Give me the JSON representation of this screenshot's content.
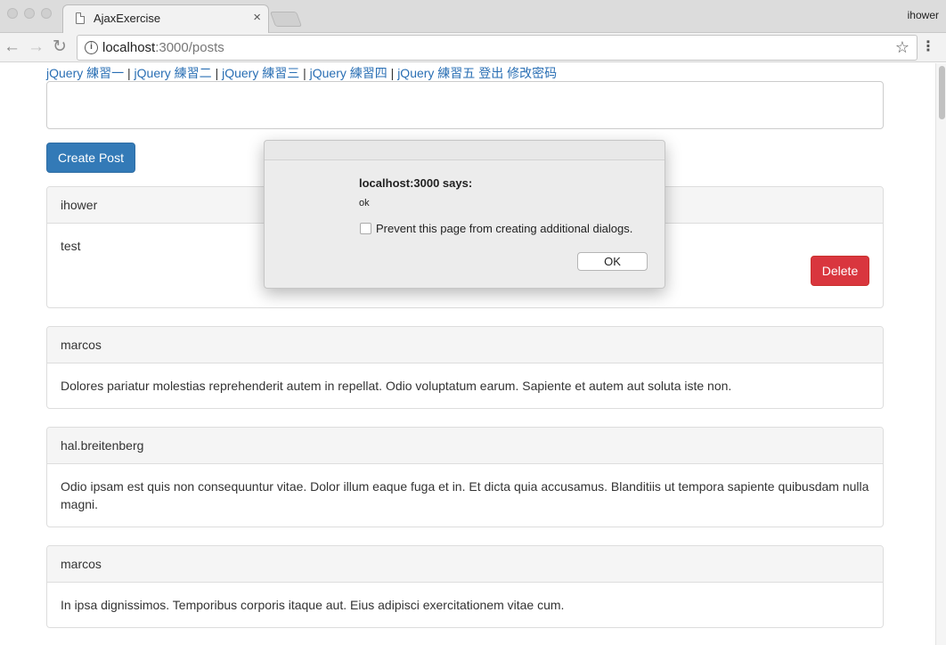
{
  "browser": {
    "tab_title": "AjaxExercise",
    "tab_close": "×",
    "profile_name": "ihower",
    "url_host": "localhost",
    "url_path": ":3000/posts",
    "back_glyph": "←",
    "forward_glyph": "→",
    "reload_glyph": "↻",
    "info_glyph": "i",
    "star_glyph": "☆",
    "menu_glyph": "⋮"
  },
  "nav": {
    "links": [
      "jQuery 練習一",
      "jQuery 練習二",
      "jQuery 練習三",
      "jQuery 練習四",
      "jQuery 練習五"
    ],
    "separator": "|",
    "logout": "登出",
    "change_password": "修改密码"
  },
  "form": {
    "textarea_value": "",
    "create_button": "Create Post"
  },
  "posts": [
    {
      "author": "ihower",
      "body": "test",
      "delete_label": "Delete"
    },
    {
      "author": "marcos",
      "body": "Dolores pariatur molestias reprehenderit autem in repellat. Odio voluptatum earum. Sapiente et autem aut soluta iste non."
    },
    {
      "author": "hal.breitenberg",
      "body": "Odio ipsam est quis non consequuntur vitae. Dolor illum eaque fuga et in. Et dicta quia accusamus. Blanditiis ut tempora sapiente quibusdam nulla magni."
    },
    {
      "author": "marcos",
      "body": "In ipsa dignissimos. Temporibus corporis itaque aut. Eius adipisci exercitationem vitae cum."
    }
  ],
  "dialog": {
    "title": "localhost:3000 says:",
    "message": "ok",
    "checkbox_label": "Prevent this page from creating additional dialogs.",
    "checkbox_checked": false,
    "ok_button": "OK"
  },
  "colors": {
    "link": "#2a6fb4",
    "primary_button": "#337ab7",
    "danger_button": "#d9363e"
  }
}
